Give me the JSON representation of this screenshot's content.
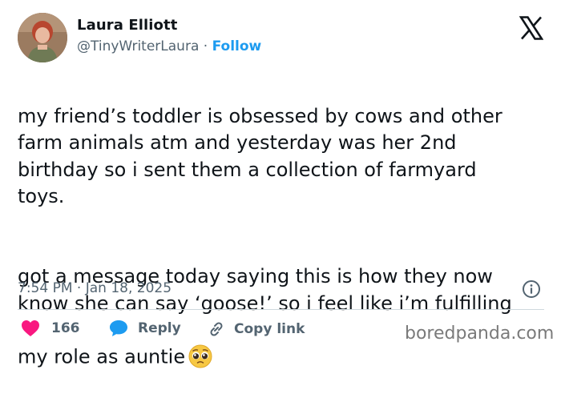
{
  "author": {
    "name": "Laura Elliott",
    "handle": "@TinyWriterLaura",
    "separator": "·",
    "follow_label": "Follow"
  },
  "post": {
    "paragraph_1": "my friend’s toddler is obsessed by cows and other\nfarm animals atm and yesterday was her 2nd\nbirthday so i sent them a collection of farmyard\ntoys.",
    "paragraph_2": "got a message today saying this is how they now\nknow she can say ‘goose!’ so i feel like i’m fulfilling\nmy role as auntie",
    "emoji": "pleading-face",
    "timestamp": "7:54 PM · Jan 18, 2025"
  },
  "actions": {
    "like_count": "166",
    "reply_label": "Reply",
    "copy_label": "Copy link"
  },
  "watermark": "boredpanda.com",
  "colors": {
    "text": "#0f1419",
    "secondary": "#536471",
    "link": "#1d9bf0",
    "like": "#f91880",
    "divider": "#cfd9de"
  }
}
